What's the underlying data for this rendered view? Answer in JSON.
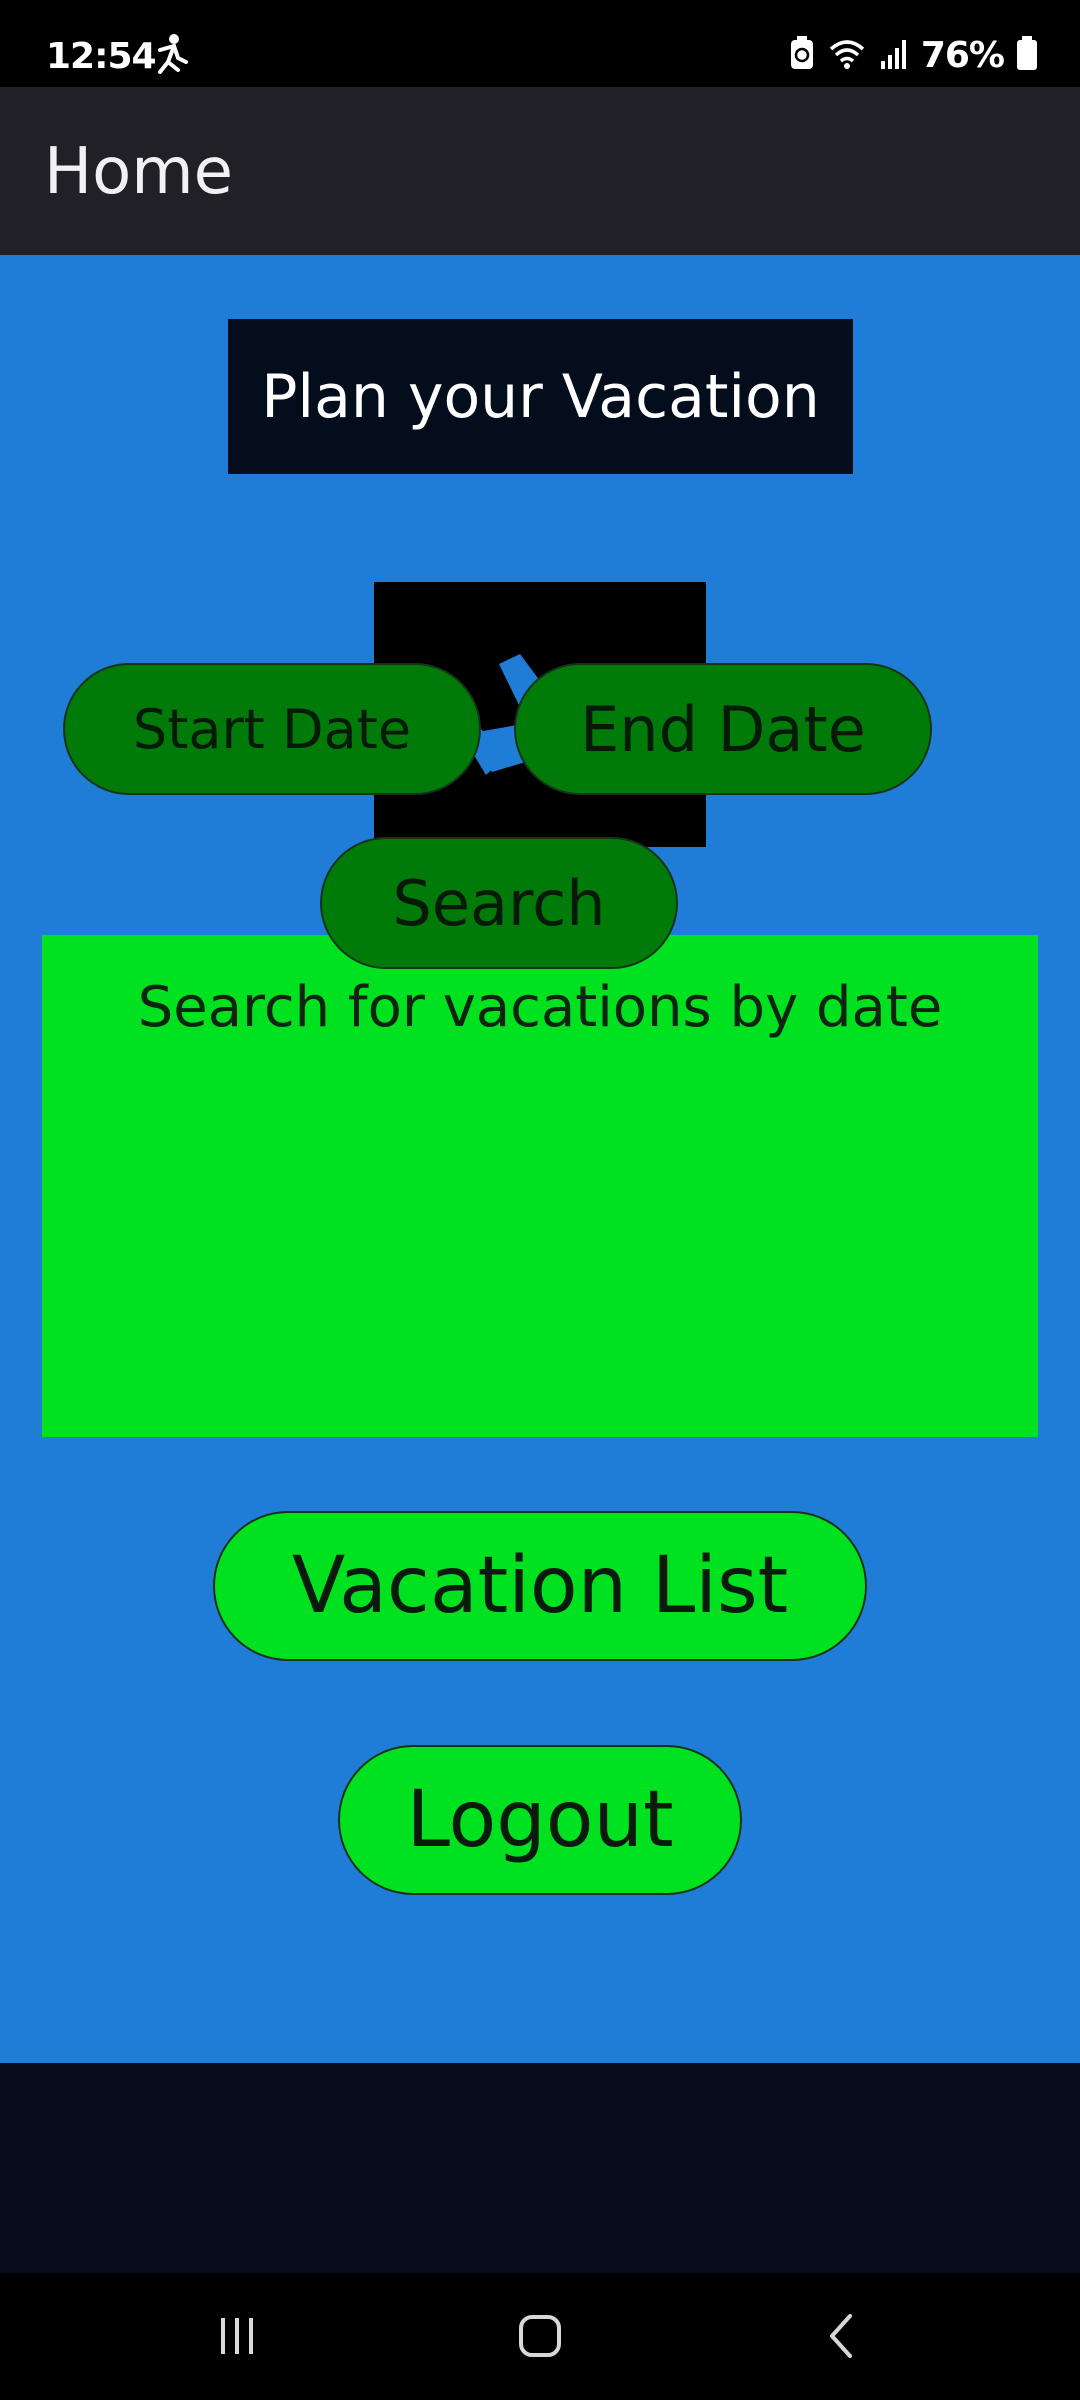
{
  "status_bar": {
    "time": "12:54",
    "battery_percent": "76%",
    "icons": [
      "runner-icon",
      "battery-saver-icon",
      "wifi-icon",
      "signal-icon",
      "battery-icon"
    ]
  },
  "app_bar": {
    "title": "Home"
  },
  "main": {
    "banner_text": "Plan your Vacation",
    "hero_icon": "airplane-takeoff-icon",
    "search_panel": {
      "title": "Search for vacations by date",
      "start_date_label": "Start Date",
      "end_date_label": "End Date",
      "search_label": "Search"
    },
    "vacation_list_label": "Vacation List",
    "logout_label": "Logout"
  },
  "nav_bar": {
    "icons": [
      "recents-icon",
      "home-icon",
      "back-icon"
    ]
  },
  "colors": {
    "background": "#1f7dd7",
    "panel_green": "#00e21f",
    "button_dark_green": "#007b0a",
    "app_bar": "#212026",
    "banner": "#040d1c"
  }
}
